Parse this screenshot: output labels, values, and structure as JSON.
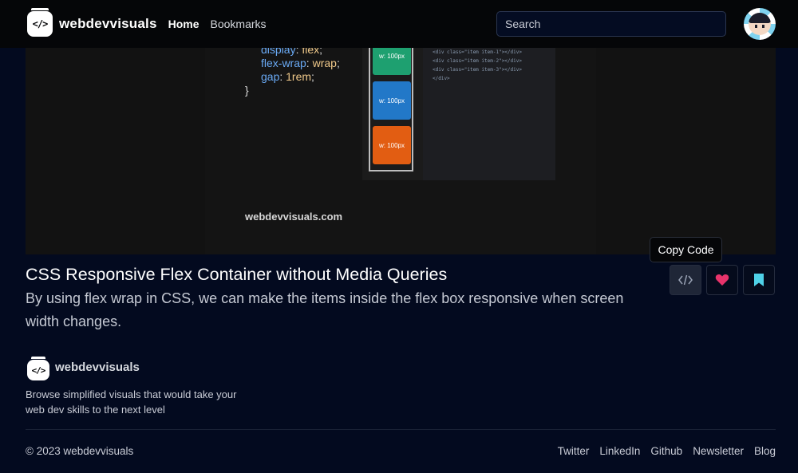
{
  "navbar": {
    "brand": "webdevvisuals",
    "links": [
      {
        "label": "Home",
        "active": true
      },
      {
        "label": "Bookmarks",
        "active": false
      }
    ],
    "search_placeholder": "Search"
  },
  "hero": {
    "code_lines": [
      {
        "prop": "display",
        "val": "flex"
      },
      {
        "prop": "flex-wrap",
        "val": "wrap"
      },
      {
        "prop": "gap",
        "val": "1rem"
      }
    ],
    "closing_brace": "}",
    "items": [
      "w: 100px",
      "w: 100px",
      "w: 100px"
    ],
    "html_lines": [
      "<div class=\"item item-1\"></div>",
      "<div class=\"item item-2\"></div>",
      "<div class=\"item item-3\"></div>",
      "</div>"
    ],
    "watermark": "webdevvisuals.com"
  },
  "post": {
    "title": "CSS Responsive Flex Container without Media Queries",
    "description": "By using flex wrap in CSS, we can make the items inside the flex box responsive when screen width changes."
  },
  "actions": {
    "tooltip": "Copy Code",
    "icons": [
      "code-icon",
      "heart-icon",
      "bookmark-icon"
    ]
  },
  "footer": {
    "brand": "webdevvisuals",
    "tagline": "Browse simplified visuals that would take your web dev skills to the next level",
    "copyright": "© 2023 webdevvisuals",
    "links": [
      "Twitter",
      "LinkedIn",
      "Github",
      "Newsletter",
      "Blog"
    ]
  },
  "colors": {
    "background": "#030a1f",
    "navbar": "#050608",
    "heart": "#e8336b",
    "bookmark": "#4fd1e8"
  }
}
